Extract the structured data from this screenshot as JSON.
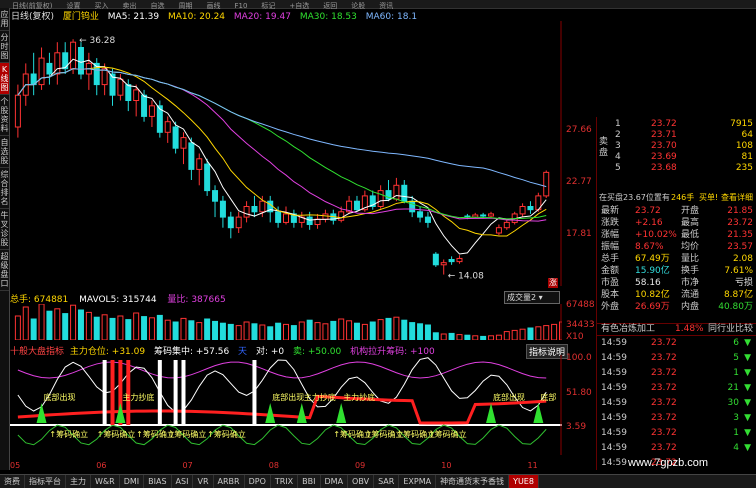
{
  "toolbar": {
    "items": [
      "日线(前复权)",
      "设置",
      "买入",
      "卖出",
      "自选",
      "周期",
      "画线",
      "F10",
      "标记",
      "+自选",
      "返回",
      "论股",
      "资讯"
    ]
  },
  "sidebar": {
    "items": [
      "应用",
      "分时图",
      "K线图",
      "个股资料",
      "自选股",
      "综合排名",
      "牛叉诊股",
      "超级盘口"
    ],
    "active_index": 2
  },
  "main_bar": {
    "period": "日线(复权)",
    "stock_name": "厦门钨业",
    "ma5": "MA5: 21.39",
    "ma10": "MA10: 20.24",
    "ma20": "MA20: 19.47",
    "ma30": "MA30: 18.53",
    "ma60": "MA60: 18.1"
  },
  "price_chart": {
    "high_label": "36.28",
    "low_label": "14.08",
    "axis_labels": [
      "27.66",
      "22.77",
      "17.81"
    ],
    "candles": [
      {
        "o": 28,
        "c": 31,
        "h": 32,
        "l": 27
      },
      {
        "o": 31,
        "c": 33,
        "h": 34,
        "l": 30
      },
      {
        "o": 33,
        "c": 32,
        "h": 35,
        "l": 31
      },
      {
        "o": 32,
        "c": 34.5,
        "h": 35.5,
        "l": 31.5
      },
      {
        "o": 34,
        "c": 33,
        "h": 35,
        "l": 32
      },
      {
        "o": 33,
        "c": 35,
        "h": 36,
        "l": 32
      },
      {
        "o": 35,
        "c": 33.5,
        "h": 36,
        "l": 33
      },
      {
        "o": 33.5,
        "c": 36,
        "h": 36.28,
        "l": 33
      },
      {
        "o": 35.5,
        "c": 33,
        "h": 36,
        "l": 32.5
      },
      {
        "o": 33,
        "c": 34,
        "h": 35,
        "l": 31.5
      },
      {
        "o": 34,
        "c": 32,
        "h": 34.5,
        "l": 31
      },
      {
        "o": 32,
        "c": 33.5,
        "h": 34,
        "l": 31
      },
      {
        "o": 33,
        "c": 31,
        "h": 33.5,
        "l": 30
      },
      {
        "o": 31,
        "c": 32.5,
        "h": 33,
        "l": 30.5
      },
      {
        "o": 32,
        "c": 30.5,
        "h": 32.5,
        "l": 29.5
      },
      {
        "o": 30.5,
        "c": 31.5,
        "h": 32,
        "l": 29
      },
      {
        "o": 31,
        "c": 29,
        "h": 31.5,
        "l": 28.5
      },
      {
        "o": 29,
        "c": 30,
        "h": 30.5,
        "l": 28
      },
      {
        "o": 30,
        "c": 27.5,
        "h": 30.5,
        "l": 27
      },
      {
        "o": 27.5,
        "c": 28.5,
        "h": 29,
        "l": 26.5
      },
      {
        "o": 28,
        "c": 26,
        "h": 28.5,
        "l": 25.5
      },
      {
        "o": 26,
        "c": 27,
        "h": 27.5,
        "l": 24.5
      },
      {
        "o": 26.5,
        "c": 24,
        "h": 27,
        "l": 23
      },
      {
        "o": 24,
        "c": 25,
        "h": 25.5,
        "l": 22.5
      },
      {
        "o": 24.5,
        "c": 22,
        "h": 25,
        "l": 21.5
      },
      {
        "o": 22,
        "c": 21,
        "h": 22.5,
        "l": 19.5
      },
      {
        "o": 21,
        "c": 19.5,
        "h": 21.5,
        "l": 18.5
      },
      {
        "o": 19.5,
        "c": 18.5,
        "h": 20,
        "l": 17.5
      },
      {
        "o": 18.5,
        "c": 19.5,
        "h": 20,
        "l": 18
      },
      {
        "o": 19.5,
        "c": 20.5,
        "h": 21,
        "l": 19
      },
      {
        "o": 20.5,
        "c": 20,
        "h": 21.5,
        "l": 19.5
      },
      {
        "o": 20,
        "c": 21,
        "h": 21.5,
        "l": 19.5
      },
      {
        "o": 21,
        "c": 20,
        "h": 21.5,
        "l": 19
      },
      {
        "o": 20,
        "c": 19,
        "h": 20.5,
        "l": 18.5
      },
      {
        "o": 19,
        "c": 19.8,
        "h": 20.5,
        "l": 18.8
      },
      {
        "o": 19.8,
        "c": 19,
        "h": 20.2,
        "l": 18.5
      },
      {
        "o": 19,
        "c": 19.5,
        "h": 20,
        "l": 18.5
      },
      {
        "o": 19.5,
        "c": 18.8,
        "h": 20,
        "l": 18.3
      },
      {
        "o": 18.8,
        "c": 19.3,
        "h": 19.8,
        "l": 18.4
      },
      {
        "o": 19.3,
        "c": 19.8,
        "h": 20.2,
        "l": 19
      },
      {
        "o": 19.8,
        "c": 19.2,
        "h": 20.2,
        "l": 18.8
      },
      {
        "o": 19.2,
        "c": 20,
        "h": 20.5,
        "l": 19
      },
      {
        "o": 20,
        "c": 21,
        "h": 21.5,
        "l": 19.8
      },
      {
        "o": 21,
        "c": 20.2,
        "h": 21.5,
        "l": 20
      },
      {
        "o": 20.2,
        "c": 21.5,
        "h": 22,
        "l": 20
      },
      {
        "o": 21.5,
        "c": 20.5,
        "h": 22,
        "l": 20.2
      },
      {
        "o": 20.5,
        "c": 22,
        "h": 22.5,
        "l": 20.3
      },
      {
        "o": 22,
        "c": 21.2,
        "h": 23,
        "l": 21
      },
      {
        "o": 21.2,
        "c": 22.5,
        "h": 23.2,
        "l": 21
      },
      {
        "o": 22.5,
        "c": 21,
        "h": 23,
        "l": 20.8
      },
      {
        "o": 21,
        "c": 20,
        "h": 21.5,
        "l": 19.5
      },
      {
        "o": 20,
        "c": 19.5,
        "h": 20.5,
        "l": 19
      },
      {
        "o": 19.5,
        "c": 19,
        "h": 20,
        "l": 18.5
      },
      {
        "o": 16,
        "c": 15,
        "h": 16.2,
        "l": 14.8
      },
      {
        "o": 15,
        "c": 15.2,
        "h": 15.5,
        "l": 14.08
      },
      {
        "o": 15.5,
        "c": 15.3,
        "h": 15.8,
        "l": 15
      },
      {
        "o": 15.3,
        "c": 15.6,
        "h": 15.9,
        "l": 15.1
      },
      {
        "o": 19.6,
        "c": 19.5,
        "h": 19.8,
        "l": 19.3
      },
      {
        "o": 19.5,
        "c": 19.7,
        "h": 19.9,
        "l": 19.4
      },
      {
        "o": 19.7,
        "c": 19.6,
        "h": 19.9,
        "l": 19.4
      },
      {
        "o": 19.6,
        "c": 19.8,
        "h": 20,
        "l": 19.5
      },
      {
        "o": 18,
        "c": 18.5,
        "h": 18.8,
        "l": 17.8
      },
      {
        "o": 18.5,
        "c": 19,
        "h": 19.3,
        "l": 18.3
      },
      {
        "o": 19,
        "c": 19.8,
        "h": 20,
        "l": 18.8
      },
      {
        "o": 19.8,
        "c": 20.5,
        "h": 20.8,
        "l": 19.5
      },
      {
        "o": 20.5,
        "c": 20.2,
        "h": 21,
        "l": 19.8
      },
      {
        "o": 20.2,
        "c": 21.5,
        "h": 21.8,
        "l": 20
      },
      {
        "o": 21.5,
        "c": 23.72,
        "h": 23.9,
        "l": 21.3
      }
    ]
  },
  "volume_bar": {
    "hand": "总手: 674881",
    "mavol5": "MAVOL5: 315744",
    "liangbi": "量比: 387665",
    "axis_labels": [
      "67488",
      "34433",
      "X10"
    ],
    "dropdown": "成交量2",
    "values": [
      40,
      55,
      35,
      60,
      48,
      52,
      44,
      58,
      50,
      46,
      38,
      42,
      36,
      40,
      34,
      45,
      39,
      37,
      41,
      33,
      30,
      36,
      32,
      29,
      35,
      31,
      28,
      26,
      24,
      30,
      27,
      25,
      22,
      28,
      26,
      24,
      30,
      33,
      29,
      27,
      31,
      35,
      32,
      28,
      26,
      30,
      34,
      36,
      38,
      33,
      29,
      27,
      25,
      12,
      10,
      11,
      9,
      8,
      7,
      6,
      7,
      8,
      14,
      16,
      18,
      20,
      22,
      24,
      26,
      30,
      34,
      38,
      46
    ]
  },
  "indicator_bar": {
    "name": "十般大盘指标",
    "main_pos": "主力仓位: +31.09",
    "conc": "筹码集中: +57.56",
    "tian": "天",
    "dui": "对: +0",
    "mai": "卖: +50.00",
    "org": "机构拉升筹码: +100",
    "help": "指标说明",
    "axis_labels": [
      "100.0",
      "51.80",
      "3.59"
    ],
    "signals": [
      "底部出现",
      "主力抄底",
      "底部出现",
      "主力抄底",
      "主力抄底",
      "底部出现",
      "底部"
    ],
    "bottom_labels": [
      "筹码确立",
      "筹码确立",
      "筹码确立",
      "筹码确立",
      "筹码确立",
      "筹码确立",
      "筹码确立",
      "筹码确立",
      "筹码确立"
    ]
  },
  "date_axis": [
    "05",
    "06",
    "07",
    "08",
    "09",
    "10",
    "11"
  ],
  "order_book": {
    "sell_label": "卖盘",
    "sell": [
      {
        "lvl": "1",
        "price": "23.72",
        "vol": "7915"
      },
      {
        "lvl": "2",
        "price": "23.71",
        "vol": "64"
      },
      {
        "lvl": "3",
        "price": "23.70",
        "vol": "108"
      },
      {
        "lvl": "4",
        "price": "23.69",
        "vol": "81"
      },
      {
        "lvl": "5",
        "price": "23.68",
        "vol": "235"
      }
    ],
    "queue_line": {
      "text1": "在买盘23.67位置有",
      "vol": "246手",
      "buy1": "买单!",
      "detail": "查看详细"
    }
  },
  "quote": [
    {
      "l": "最新",
      "v": "23.72",
      "l2": "开盘",
      "v2": "21.85",
      "c1": "red",
      "c2": "red"
    },
    {
      "l": "涨跌",
      "v": "+2.16",
      "l2": "最高",
      "v2": "23.72",
      "c1": "red",
      "c2": "red"
    },
    {
      "l": "涨幅",
      "v": "+10.02%",
      "l2": "最低",
      "v2": "21.35",
      "c1": "red",
      "c2": "red"
    },
    {
      "l": "振幅",
      "v": "8.67%",
      "l2": "均价",
      "v2": "23.57",
      "c1": "red",
      "c2": "red"
    },
    {
      "l": "总手",
      "v": "67.49万",
      "l2": "量比",
      "v2": "2.08",
      "c1": "yellow",
      "c2": "yellow"
    },
    {
      "l": "金额",
      "v": "15.90亿",
      "l2": "换手",
      "v2": "7.61%",
      "c1": "cyan",
      "c2": "yellow"
    },
    {
      "l": "市盈",
      "v": "58.16",
      "l2": "市净",
      "v2": "亏损",
      "c1": "white",
      "c2": "white"
    },
    {
      "l": "股本",
      "v": "10.82亿",
      "l2": "流通",
      "v2": "8.87亿",
      "c1": "yellow",
      "c2": "yellow"
    },
    {
      "l": "外盘",
      "v": "26.69万",
      "l2": "内盘",
      "v2": "40.80万",
      "c1": "red",
      "c2": "green"
    }
  ],
  "industry": {
    "name": "有色冶炼加工",
    "pct": "1.48%",
    "compare": "同行业比较"
  },
  "ticks": [
    {
      "t": "14:59",
      "p": "23.72",
      "v": "6",
      "dir": "down"
    },
    {
      "t": "14:59",
      "p": "23.72",
      "v": "5",
      "dir": "down"
    },
    {
      "t": "14:59",
      "p": "23.72",
      "v": "1",
      "dir": "down"
    },
    {
      "t": "14:59",
      "p": "23.72",
      "v": "21",
      "dir": "down"
    },
    {
      "t": "14:59",
      "p": "23.72",
      "v": "30",
      "dir": "down"
    },
    {
      "t": "14:59",
      "p": "23.72",
      "v": "3",
      "dir": "down"
    },
    {
      "t": "14:59",
      "p": "23.72",
      "v": "1",
      "dir": "down"
    },
    {
      "t": "14:59",
      "p": "23.72",
      "v": "4",
      "dir": "down"
    },
    {
      "t": "14:59",
      "p": "23.72",
      "v": "",
      "dir": ""
    }
  ],
  "tabs": {
    "items": [
      "资费",
      "指标平台",
      "主力",
      "W&R",
      "DMI",
      "BIAS",
      "ASI",
      "VR",
      "ARBR",
      "DPO",
      "TRIX",
      "BBI",
      "DMA",
      "OBV",
      "SAR",
      "EXPMA",
      "神奇通货末予香钱",
      "YUE8"
    ],
    "active_index": 17
  },
  "watermark": "www.7gpzb.com",
  "colors": {
    "up": "#ff3333",
    "down": "#22dddd",
    "ma5": "#ffffff",
    "ma10": "#ffd700",
    "ma20": "#e040e0",
    "ma30": "#30e030",
    "ma60": "#7fb8ff"
  }
}
